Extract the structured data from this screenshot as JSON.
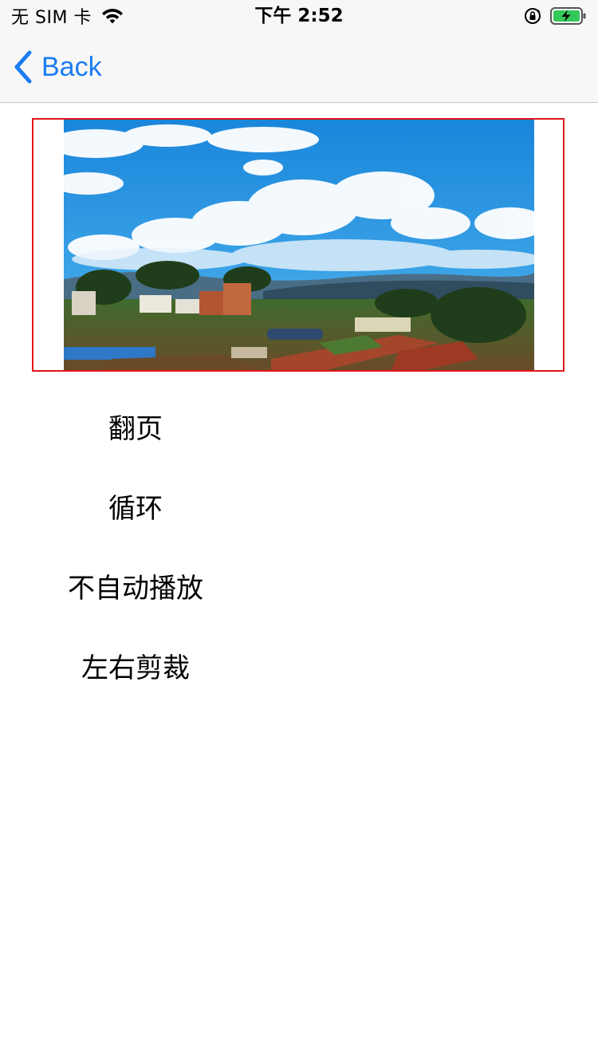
{
  "status_bar": {
    "carrier": "无 SIM 卡",
    "time": "下午 2:52",
    "wifi_icon": "wifi-icon",
    "orientation_lock_icon": "orientation-lock-icon",
    "battery_icon": "battery-charging-icon",
    "battery_color": "#34c759"
  },
  "nav_bar": {
    "back_label": "Back",
    "accent_color": "#1a7cf3"
  },
  "banner": {
    "image_icon": "landscape-photo",
    "border_color": "#e0161a"
  },
  "options": [
    {
      "label": "翻页"
    },
    {
      "label": "循环"
    },
    {
      "label": "不自动播放"
    },
    {
      "label": "左右剪裁"
    }
  ]
}
